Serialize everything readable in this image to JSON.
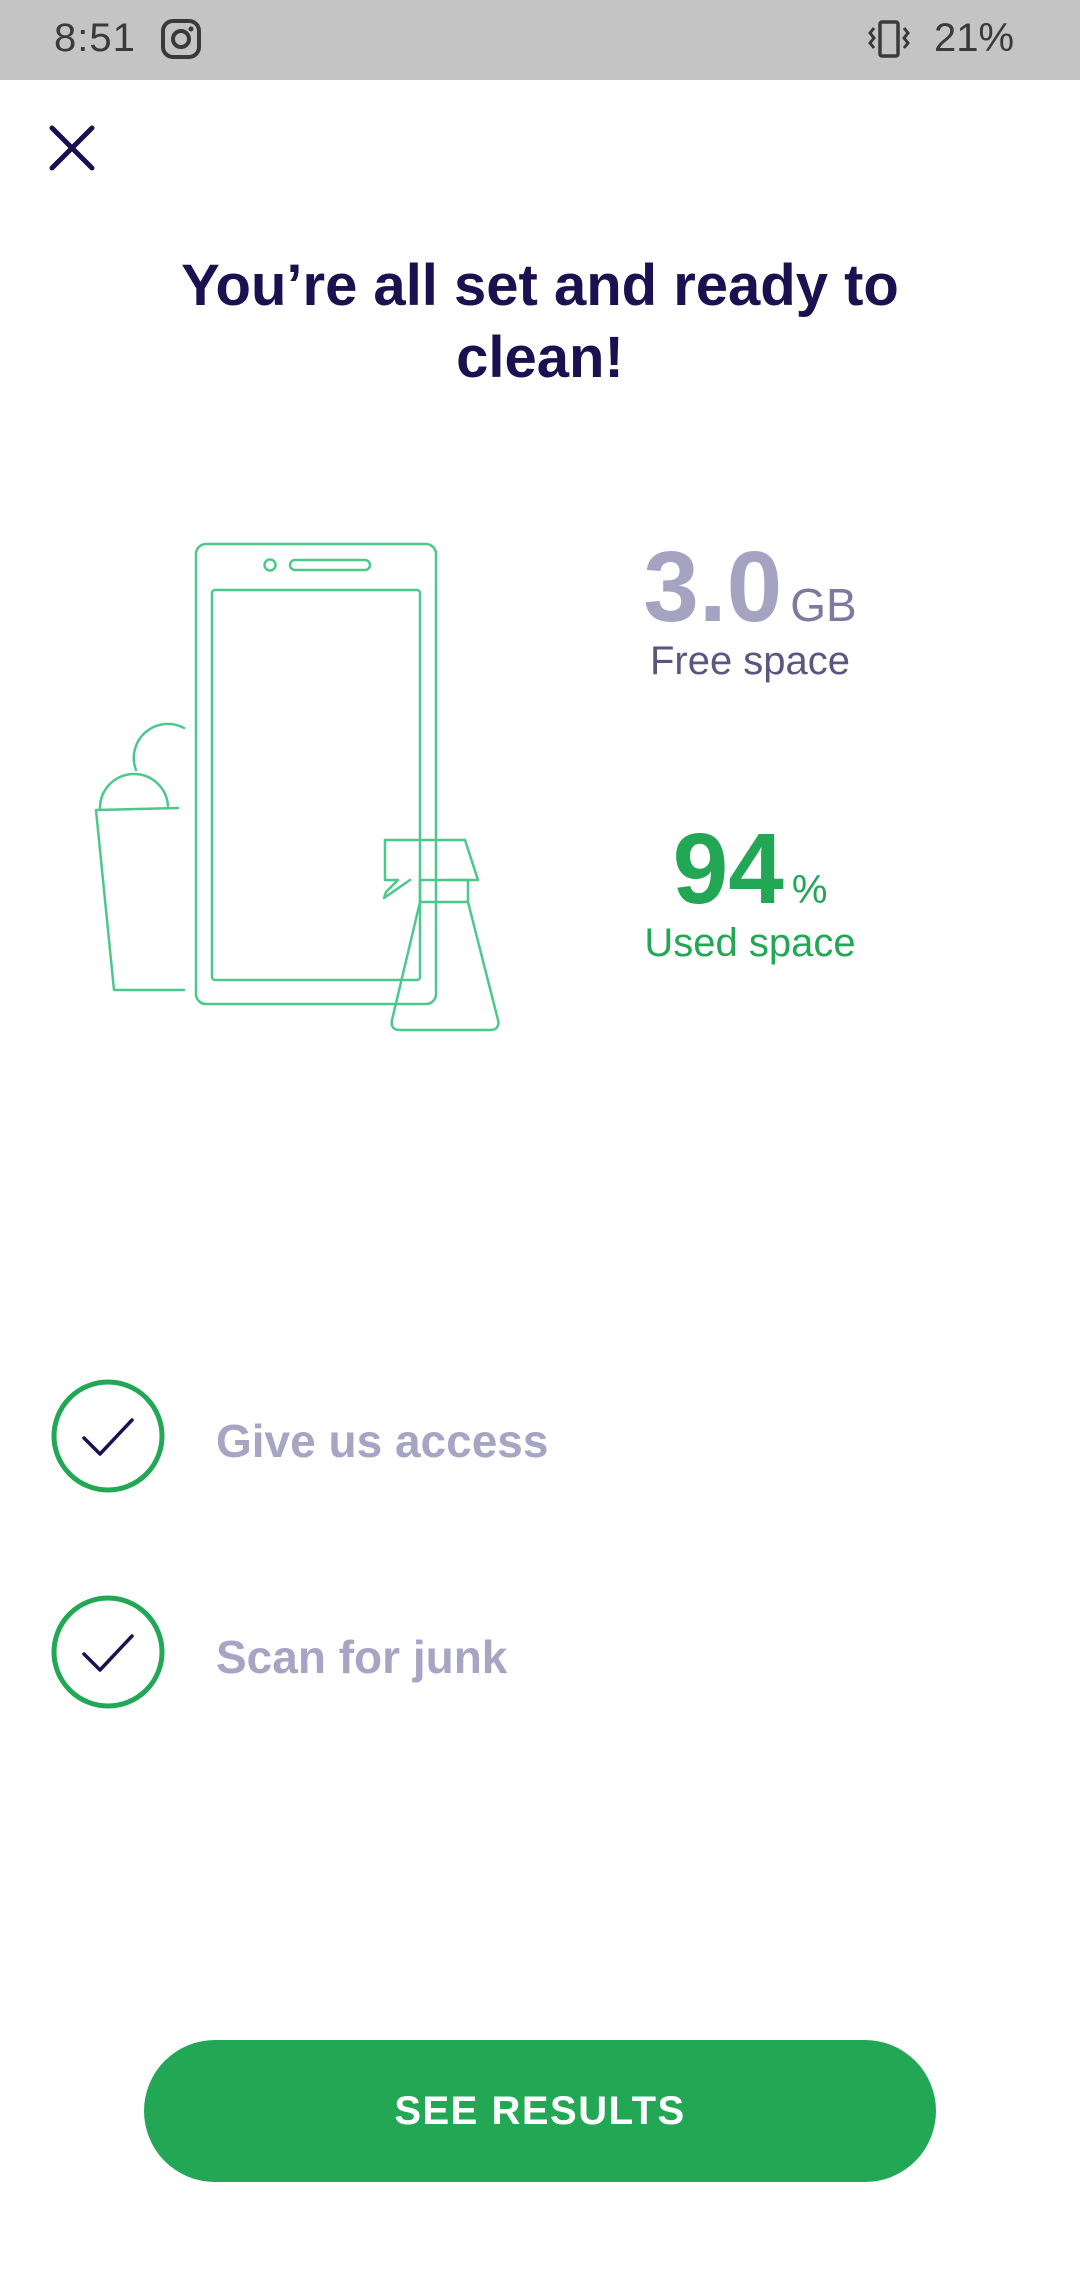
{
  "status_bar": {
    "time": "8:51",
    "battery": "21%",
    "icons": [
      "instagram-icon",
      "vibrate-icon"
    ]
  },
  "header": {
    "close_icon": "close-icon"
  },
  "title": "You’re all set and ready to clean!",
  "storage": {
    "free_value": "3.0",
    "free_unit": "GB",
    "free_label": "Free space",
    "used_value": "94",
    "used_unit": "%",
    "used_label": "Used space"
  },
  "steps": [
    {
      "label": "Give us access",
      "done": true
    },
    {
      "label": "Scan for junk",
      "done": true
    }
  ],
  "cta": {
    "label": "SEE RESULTS"
  },
  "colors": {
    "title": "#1b1150",
    "accent_green": "#22a755",
    "muted_lavender": "#a6a2c2",
    "status_bar_bg": "#c4c4c4"
  }
}
